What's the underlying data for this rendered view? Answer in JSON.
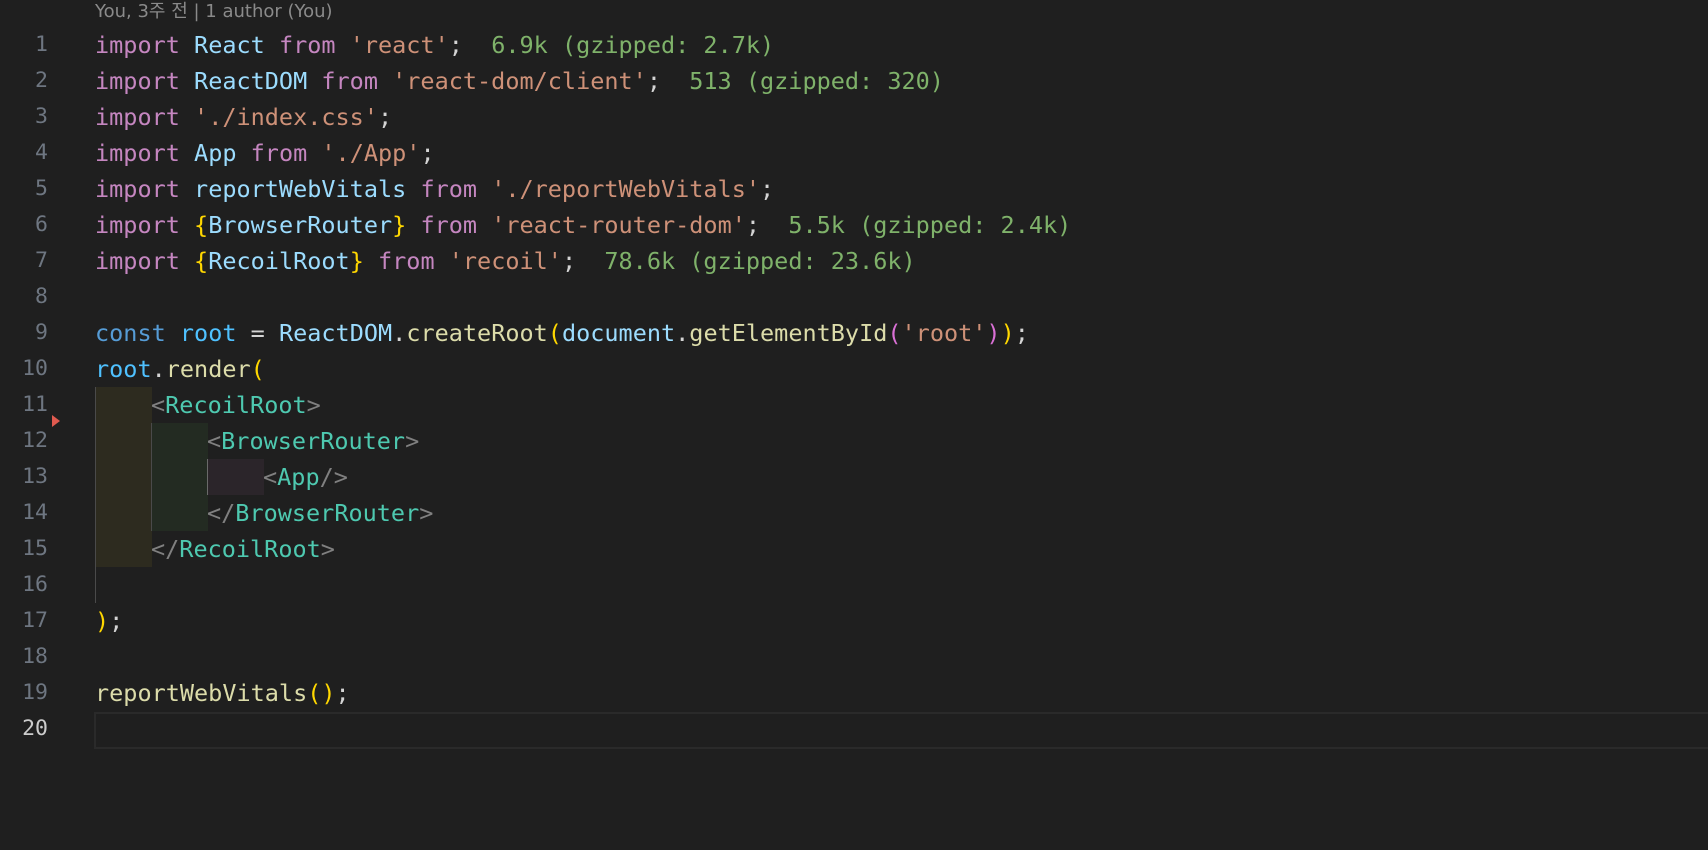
{
  "codelens": {
    "blame": "You, 3주 전 | 1 author (You)"
  },
  "gutter": {
    "line_numbers": [
      "1",
      "2",
      "3",
      "4",
      "5",
      "6",
      "7",
      "8",
      "9",
      "10",
      "11",
      "12",
      "13",
      "14",
      "15",
      "16",
      "17",
      "18",
      "19",
      "20"
    ],
    "active_line": "20"
  },
  "code": {
    "l1": {
      "kw": "import",
      "name": "React",
      "from": "from",
      "str": "'react'",
      "semi": ";",
      "hint": "6.9k (gzipped: 2.7k)"
    },
    "l2": {
      "kw": "import",
      "name": "ReactDOM",
      "from": "from",
      "str": "'react-dom/client'",
      "semi": ";",
      "hint": "513 (gzipped: 320)"
    },
    "l3": {
      "kw": "import",
      "str": "'./index.css'",
      "semi": ";"
    },
    "l4": {
      "kw": "import",
      "name": "App",
      "from": "from",
      "str": "'./App'",
      "semi": ";"
    },
    "l5": {
      "kw": "import",
      "name": "reportWebVitals",
      "from": "from",
      "str": "'./reportWebVitals'",
      "semi": ";"
    },
    "l6": {
      "kw": "import",
      "open": "{",
      "name": "BrowserRouter",
      "close": "}",
      "from": "from",
      "str": "'react-router-dom'",
      "semi": ";",
      "hint": "5.5k (gzipped: 2.4k)"
    },
    "l7": {
      "kw": "import",
      "open": "{",
      "name": "RecoilRoot",
      "close": "}",
      "from": "from",
      "str": "'recoil'",
      "semi": ";",
      "hint": "78.6k (gzipped: 23.6k)"
    },
    "l9": {
      "kw": "const",
      "var": "root",
      "eq": "=",
      "obj": "ReactDOM",
      "dot": ".",
      "fn": "createRoot",
      "p1": "(",
      "obj2": "document",
      "dot2": ".",
      "fn2": "getElementById",
      "p2": "(",
      "str": "'root'",
      "p2c": ")",
      "p1c": ")",
      "semi": ";"
    },
    "l10": {
      "obj": "root",
      "dot": ".",
      "fn": "render",
      "p": "("
    },
    "l11": {
      "lt": "<",
      "tag": "RecoilRoot",
      "gt": ">"
    },
    "l12": {
      "lt": "<",
      "tag": "BrowserRouter",
      "gt": ">"
    },
    "l13": {
      "lt": "<",
      "tag": "App",
      "gt": "/>"
    },
    "l14": {
      "lt": "</",
      "tag": "BrowserRouter",
      "gt": ">"
    },
    "l15": {
      "lt": "</",
      "tag": "RecoilRoot",
      "gt": ">"
    },
    "l17": {
      "p": ")",
      "semi": ";"
    },
    "l19": {
      "fn": "reportWebVitals",
      "p": "()",
      "semi": ";"
    }
  }
}
